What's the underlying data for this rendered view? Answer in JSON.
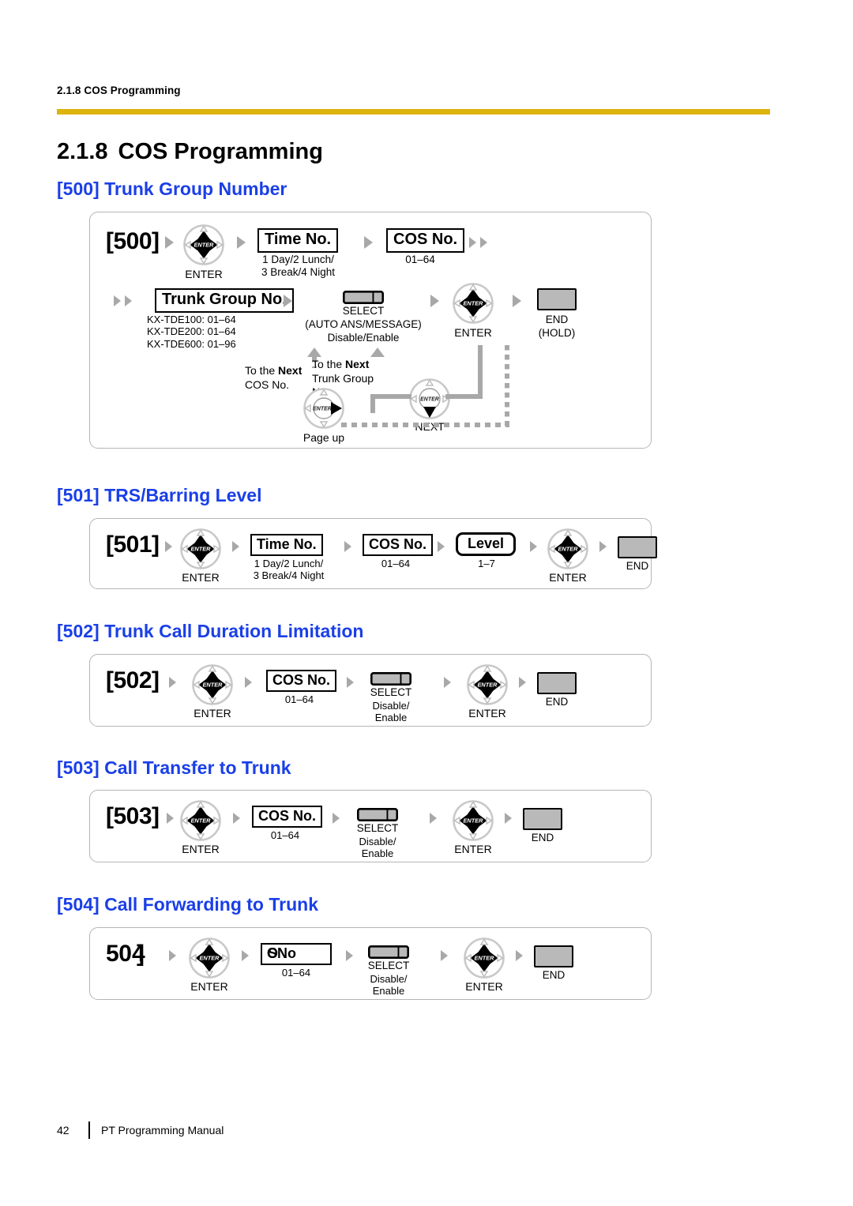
{
  "document": {
    "running_head": "2.1.8 COS Programming",
    "section_number": "2.1.8",
    "section_title": "COS Programming",
    "accent_rule_color": "#ddb40e",
    "heading_color": "#1a3fe8"
  },
  "footer": {
    "page_number": "42",
    "manual_title": "PT Programming Manual"
  },
  "labels": {
    "enter": "ENTER",
    "select": "SELECT",
    "end": "END",
    "end_hold": "(HOLD)",
    "next": "NEXT",
    "page_up": "Page up",
    "time_no": "Time No.",
    "cos_no": "COS No.",
    "trunk_group_no": "Trunk Group No.",
    "level": "Level",
    "time_no_range_1": "1 Day/2 Lunch/",
    "time_no_range_2": "3 Break/4 Night",
    "cos_range": "01–64",
    "level_range": "1–7",
    "select_disable_1": "Disable/",
    "select_disable_2": "Enable",
    "select_disable_enable": "Disable/Enable",
    "auto_ans_message": "(AUTO ANS/MESSAGE)"
  },
  "programs": [
    {
      "id": "500",
      "code": "[500]",
      "heading": "[500] Trunk Group Number",
      "trunk_ranges": [
        "KX-TDE100: 01–64",
        "KX-TDE200: 01–64",
        "KX-TDE600: 01–96"
      ],
      "loop": {
        "to_next_cos_1": "To the ",
        "to_next_cos_bold": "Next",
        "to_next_cos_2": "COS No.",
        "to_next_trunk_1": "To the ",
        "to_next_trunk_bold": "Next",
        "to_next_trunk_2": "Trunk Group",
        "to_next_trunk_3": "No."
      }
    },
    {
      "id": "501",
      "code": "[501]",
      "heading": "[501] TRS/Barring Level"
    },
    {
      "id": "502",
      "code": "[502]",
      "heading": "[502] Trunk Call Duration Limitation"
    },
    {
      "id": "503",
      "code": "[503]",
      "heading": "[503] Call Transfer to Trunk"
    },
    {
      "id": "504",
      "code": "[504]",
      "code_glyphs": {
        "a": "5",
        "b": "0",
        "c": "4",
        "d": "]"
      },
      "box_glyphs": {
        "a": "C",
        "b": "O",
        "c": "S",
        "d": "No"
      },
      "heading": "[504] Call Forwarding to Trunk"
    }
  ]
}
